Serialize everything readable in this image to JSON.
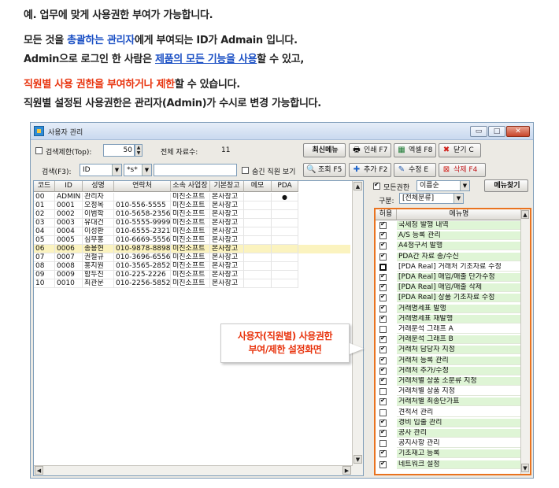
{
  "intro": {
    "line1": "예. 업무에 맞게 사용권한 부여가 가능합니다.",
    "line2_a": "모든 것을 ",
    "line2_b": "총괄하는 관리자",
    "line2_c": "에게 부여되는 ID가 Admain 입니다.",
    "line3_a": "Admin으로 로그인 한 사람은 ",
    "line3_b": "제품의 모든 기능을 사용",
    "line3_c": "할 수 있고,",
    "line4_a": "직원별 사용 권한을 부여하거나 제한",
    "line4_b": "할 수 있습니다.",
    "line5": "직원별 설정된 사용권한은 관리자(Admin)가 수시로 변경 가능합니다."
  },
  "window": {
    "title": "사용자 관리",
    "min": "▭",
    "max": "□",
    "close": "✕"
  },
  "toolbar1": {
    "search_limit_label": "검색제한(Top):",
    "search_limit_value": "50",
    "total_label": "전체 자료수:",
    "total_value": "11",
    "refresh_btn": "최신메뉴",
    "print_btn": "인쇄 F7",
    "excel_btn": "엑셀 F8",
    "close_btn": "닫기 C"
  },
  "toolbar2": {
    "search_label": "검색(F3):",
    "search_field": "ID",
    "search_op": "*s*",
    "search_value": "",
    "hidden_label": "숨긴 직원 보기",
    "query_btn": "조회 F5",
    "add_btn": "추가 F2",
    "edit_btn": "수정 E",
    "delete_btn": "삭제 F4"
  },
  "grid": {
    "columns": [
      "코드",
      "ID",
      "성명",
      "연락처",
      "소속 사업장",
      "기본창고",
      "메모",
      "PDA"
    ],
    "rows": [
      [
        "00",
        "ADMIN",
        "관리자",
        "",
        "미진소프트",
        "본사창고",
        "",
        "●"
      ],
      [
        "01",
        "0001",
        "오정목",
        "010-556-5555",
        "미진소프트",
        "본사창고",
        "",
        ""
      ],
      [
        "02",
        "0002",
        "이범학",
        "010-5658-2356",
        "미진소프트",
        "본사창고",
        "",
        ""
      ],
      [
        "03",
        "0003",
        "유대건",
        "010-5555-9999",
        "미진소프트",
        "본사창고",
        "",
        ""
      ],
      [
        "04",
        "0004",
        "이성환",
        "010-6555-2321",
        "미진소프트",
        "본사창고",
        "",
        ""
      ],
      [
        "05",
        "0005",
        "심무홍",
        "010-6669-5556",
        "미진소프트",
        "본사창고",
        "",
        ""
      ],
      [
        "06",
        "0006",
        "송용현",
        "010-9878-8898",
        "미진소프트",
        "본사창고",
        "",
        ""
      ],
      [
        "07",
        "0007",
        "권철규",
        "010-3696-6556",
        "미진소프트",
        "본사창고",
        "",
        ""
      ],
      [
        "08",
        "0008",
        "홍지원",
        "010-3565-2852",
        "미진소프트",
        "본사창고",
        "",
        ""
      ],
      [
        "09",
        "0009",
        "함두진",
        "010-225-2226",
        "미진소프트",
        "본사창고",
        "",
        ""
      ],
      [
        "10",
        "0010",
        "최관문",
        "010-2256-5852",
        "미진소프트",
        "본사창고",
        "",
        ""
      ]
    ],
    "selected_row": 6
  },
  "permissions_panel": {
    "all_perm_label": "모든권한",
    "sort_value": "이름순",
    "menu_find_btn": "메뉴찾기",
    "category_label": "구분:",
    "category_value": "[전체분류]",
    "col_allow": "허용",
    "col_menu": "메뉴명",
    "items": [
      {
        "name": "국세청 발행 내역",
        "on": true,
        "g": true
      },
      {
        "name": "A/S 등록 관리",
        "on": true,
        "g": true
      },
      {
        "name": "A4청구서 발행",
        "on": true,
        "g": true
      },
      {
        "name": "PDA간 자료 송/수신",
        "on": true,
        "g": true
      },
      {
        "name": "[PDA Real] 거래처 기초자료 수정",
        "on": false,
        "g": false
      },
      {
        "name": "[PDA Real] 매입/매출 단가수정",
        "on": true,
        "g": true
      },
      {
        "name": "[PDA Real] 매입/매출 삭제",
        "on": true,
        "g": true
      },
      {
        "name": "[PDA Real] 상품 기초자료 수정",
        "on": true,
        "g": true
      },
      {
        "name": "거래명세표 발행",
        "on": true,
        "g": true
      },
      {
        "name": "거래명세표 재발행",
        "on": true,
        "g": true
      },
      {
        "name": "거래분석 그래프 A",
        "on": false,
        "g": false
      },
      {
        "name": "거래분석 그래프 B",
        "on": true,
        "g": true
      },
      {
        "name": "거래처 담당자 지정",
        "on": true,
        "g": true
      },
      {
        "name": "거래처 등록 관리",
        "on": true,
        "g": true
      },
      {
        "name": "거래처 추가/수정",
        "on": true,
        "g": true
      },
      {
        "name": "거래처별 상품 소분류 지정",
        "on": true,
        "g": true
      },
      {
        "name": "거래처별 상품 지정",
        "on": false,
        "g": false
      },
      {
        "name": "거래처별 최종단가표",
        "on": true,
        "g": true
      },
      {
        "name": "견적서 관리",
        "on": false,
        "g": false
      },
      {
        "name": "경비 입출 관리",
        "on": true,
        "g": true
      },
      {
        "name": "공사 관리",
        "on": true,
        "g": true
      },
      {
        "name": "공지사항 관리",
        "on": false,
        "g": false
      },
      {
        "name": "기초재고 등록",
        "on": true,
        "g": true
      },
      {
        "name": "네트워크 설정",
        "on": true,
        "g": true
      }
    ]
  },
  "callout": {
    "line1": "사용자(직원별) 사용권한",
    "line2": "부여/제한 설정화면"
  },
  "colors": {
    "accent_orange": "#e9731f",
    "highlight_red": "#e8340e",
    "highlight_blue": "#1a4fc4",
    "row_selected": "#fbf3bf",
    "perm_green": "#dff5d6"
  }
}
